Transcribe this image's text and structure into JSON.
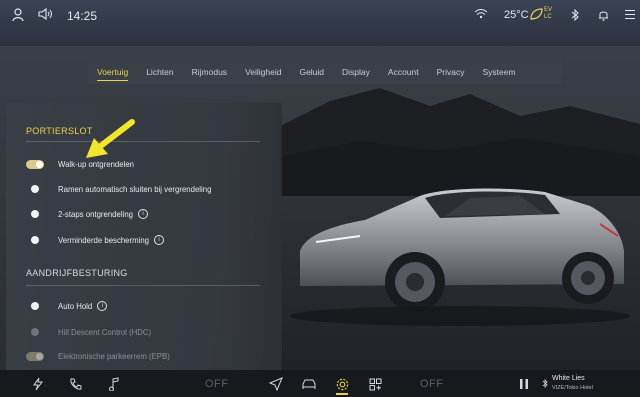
{
  "status": {
    "time": "14:25",
    "temperature": "25°C",
    "badge_top": "EV",
    "badge_bottom": "LC",
    "icons": [
      "user-icon",
      "volume-icon",
      "wifi-icon",
      "leaf-eco-icon",
      "bluetooth-icon",
      "bell-icon",
      "menu-icon"
    ]
  },
  "tabs": [
    {
      "label": "Voertuig",
      "active": true
    },
    {
      "label": "Lichten"
    },
    {
      "label": "Rijmodus"
    },
    {
      "label": "Veiligheid"
    },
    {
      "label": "Geluid"
    },
    {
      "label": "Display"
    },
    {
      "label": "Account"
    },
    {
      "label": "Privacy"
    },
    {
      "label": "Systeem"
    }
  ],
  "sections": {
    "portierslot": {
      "title": "PORTIERSLOT",
      "items": [
        {
          "label": "Walk-up ontgrendelen",
          "control": "toggle",
          "on": true
        },
        {
          "label": "Ramen automatisch sluiten bij vergrendeling",
          "control": "radio"
        },
        {
          "label": "2-staps ontgrendeling",
          "control": "radio",
          "info": true
        },
        {
          "label": "Verminderde bescherming",
          "control": "radio",
          "info": true
        }
      ]
    },
    "aandrijf": {
      "title": "AANDRIJFBESTURING",
      "items": [
        {
          "label": "Auto Hold",
          "control": "radio",
          "info": true
        },
        {
          "label": "Hill Descent Control (HDC)",
          "control": "radio",
          "disabled": true
        },
        {
          "label": "Elektronische parkeerrem (EPB)",
          "control": "toggle",
          "disabled": true
        }
      ]
    }
  },
  "bottom": {
    "left_off": "OFF",
    "right_off": "OFF",
    "icons": [
      "charging-icon",
      "phone-icon",
      "music-icon",
      "navigation-icon",
      "car-icon",
      "settings-gear-icon",
      "apps-grid-icon",
      "pause-icon"
    ],
    "media_title": "White Lies",
    "media_subtitle": "VIZE/Tokio Hotel"
  },
  "colors": {
    "accent": "#e7d44a",
    "annotation_arrow": "#f2e62b"
  }
}
